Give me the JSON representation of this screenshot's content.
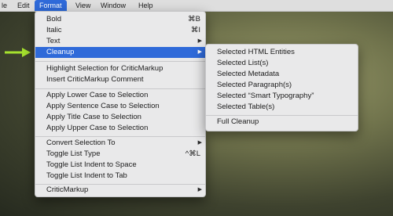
{
  "menubar": {
    "items": [
      {
        "label": "le"
      },
      {
        "label": "Edit"
      },
      {
        "label": "Format",
        "active": true
      },
      {
        "label": "View"
      },
      {
        "label": "Window"
      },
      {
        "label": "Help"
      }
    ]
  },
  "format_menu": {
    "items": [
      {
        "label": "Bold",
        "shortcut": "⌘B"
      },
      {
        "label": "Italic",
        "shortcut": "⌘I"
      },
      {
        "label": "Text",
        "submenu": true
      },
      {
        "label": "Cleanup",
        "submenu": true,
        "highlighted": true
      },
      {
        "label": "Highlight Selection for CriticMarkup"
      },
      {
        "label": "Insert CriticMarkup Comment"
      },
      {
        "label": "Apply Lower Case to Selection"
      },
      {
        "label": "Apply Sentence Case to Selection"
      },
      {
        "label": "Apply Title Case to Selection"
      },
      {
        "label": "Apply Upper Case to Selection"
      },
      {
        "label": "Convert Selection To",
        "submenu": true
      },
      {
        "label": "Toggle List Type",
        "shortcut": "^⌘L"
      },
      {
        "label": "Toggle List Indent to Space"
      },
      {
        "label": "Toggle List Indent to Tab"
      },
      {
        "label": "CriticMarkup",
        "submenu": true
      }
    ]
  },
  "cleanup_submenu": {
    "items": [
      {
        "label": "Selected HTML Entities"
      },
      {
        "label": "Selected List(s)"
      },
      {
        "label": "Selected Metadata"
      },
      {
        "label": "Selected Paragraph(s)"
      },
      {
        "label": "Selected “Smart Typography”"
      },
      {
        "label": "Selected Table(s)"
      },
      {
        "label": "Full Cleanup"
      }
    ]
  },
  "icons": {
    "submenu_arrow": "▶",
    "pointer": "green-arrow-icon"
  },
  "colors": {
    "highlight": "#2f6ad9",
    "pointer_arrow": "#a6e22e"
  }
}
